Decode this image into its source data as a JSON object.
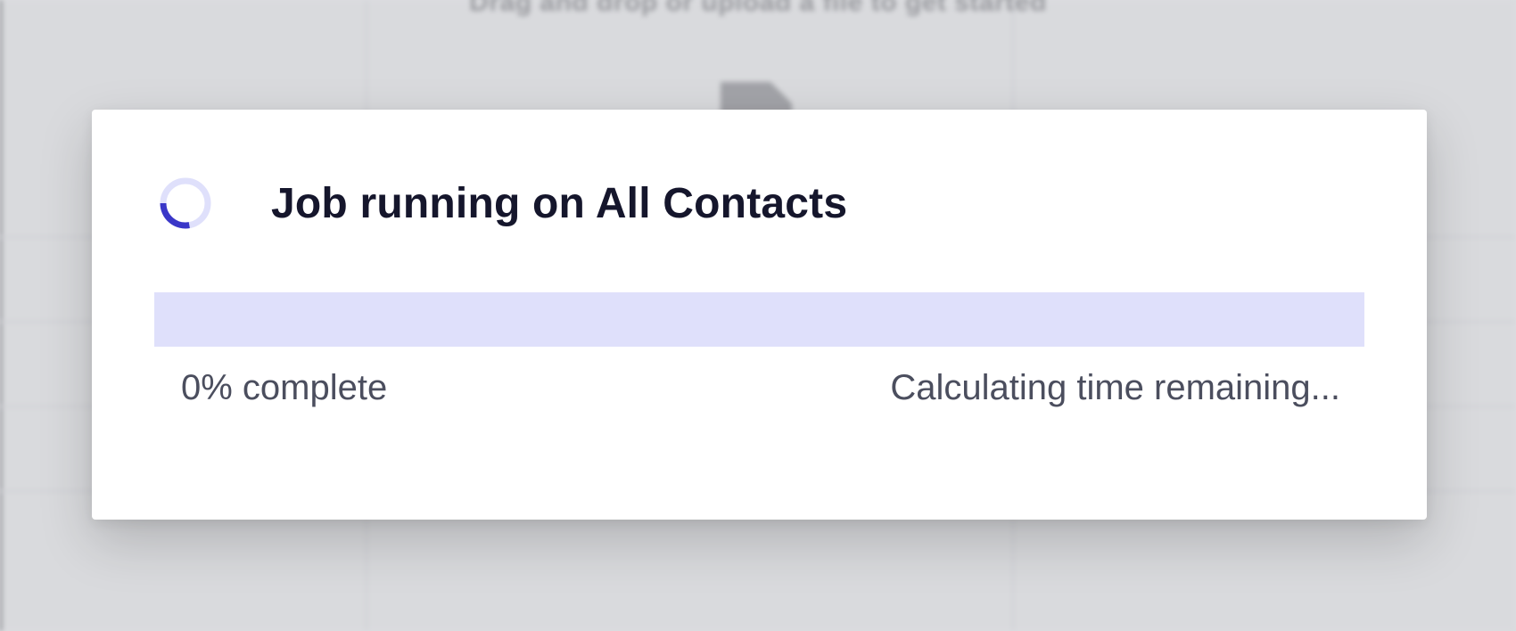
{
  "background": {
    "caption": "Drag and drop or upload a file to get started"
  },
  "modal": {
    "title": "Job running on All Contacts",
    "progress": {
      "percent": 0,
      "complete_label": "0% complete",
      "time_remaining_label": "Calculating time remaining..."
    }
  },
  "icons": {
    "spinner": "loading-spinner-icon",
    "background_file": "file-icon"
  },
  "colors": {
    "accent": "#3a37c8",
    "progress_track": "#dfe0fb",
    "title_text": "#15162c",
    "body_text": "#4b4e5e",
    "backdrop": "#dcdde0"
  }
}
